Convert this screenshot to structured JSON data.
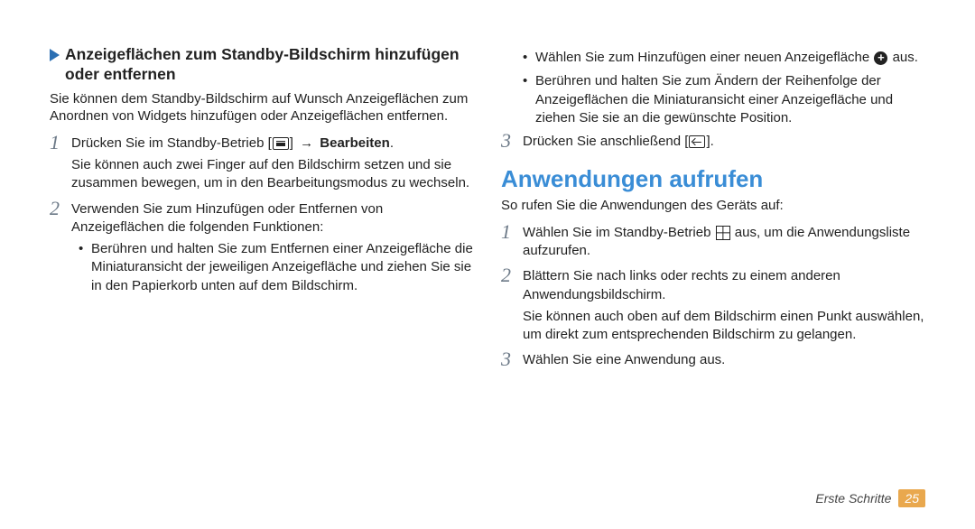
{
  "left": {
    "section_title": "Anzeigeflächen zum Standby-Bildschirm hinzufügen oder entfernen",
    "intro": "Sie können dem Standby-Bildschirm auf Wunsch Anzeigeflächen zum Anordnen von Widgets hinzufügen oder Anzeigeflächen entfernen.",
    "step1_a": "Drücken Sie im Standby-Betrieb [",
    "step1_b": "] ",
    "step1_arrow": "→",
    "step1_bold": " Bearbeiten",
    "step1_dot": ".",
    "step1_sub": "Sie können auch zwei Finger auf den Bildschirm setzen und sie zusammen bewegen, um in den Bearbeitungsmodus zu wechseln.",
    "step2": "Verwenden Sie zum Hinzufügen oder Entfernen von Anzeigeflächen die folgenden Funktionen:",
    "bullet1": "Berühren und halten Sie zum Entfernen einer Anzeigefläche die Miniaturansicht der jeweiligen Anzeigefläche und ziehen Sie sie in den Papierkorb unten auf dem Bildschirm."
  },
  "right": {
    "bullet2_a": "Wählen Sie zum Hinzufügen einer neuen Anzeigefläche ",
    "bullet2_b": " aus.",
    "bullet3": "Berühren und halten Sie zum Ändern der Reihenfolge der Anzeigeflächen die Miniaturansicht einer Anzeigefläche und ziehen Sie sie an die gewünschte Position.",
    "step3_a": "Drücken Sie anschließend [",
    "step3_b": "].",
    "heading": "Anwendungen aufrufen",
    "intro2": "So rufen Sie die Anwendungen des Geräts auf:",
    "s1_a": "Wählen Sie im Standby-Betrieb ",
    "s1_b": " aus, um die Anwendungsliste aufzurufen.",
    "s2": "Blättern Sie nach links oder rechts zu einem anderen Anwendungsbildschirm.",
    "s2_sub": "Sie können auch oben auf dem Bildschirm einen Punkt auswählen, um direkt zum entsprechenden Bildschirm zu gelangen.",
    "s3": "Wählen Sie eine Anwendung aus."
  },
  "footer": {
    "label": "Erste Schritte",
    "page": "25"
  }
}
